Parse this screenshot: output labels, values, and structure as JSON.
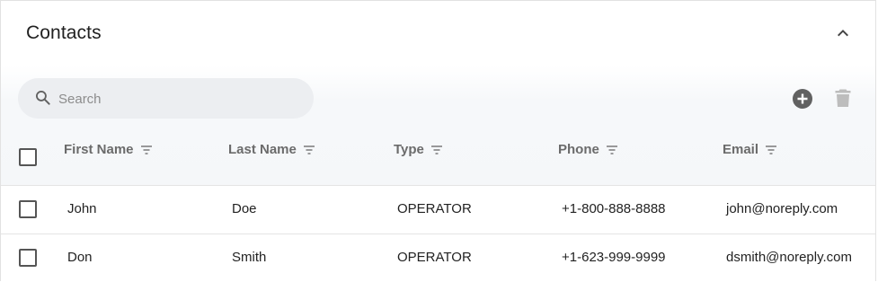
{
  "panel": {
    "title": "Contacts"
  },
  "toolbar": {
    "search_placeholder": "Search",
    "search_value": ""
  },
  "table": {
    "columns": [
      {
        "label": "First Name"
      },
      {
        "label": "Last Name"
      },
      {
        "label": "Type"
      },
      {
        "label": "Phone"
      },
      {
        "label": "Email"
      }
    ],
    "rows": [
      {
        "first": "John",
        "last": "Doe",
        "type": "OPERATOR",
        "phone": "+1-800-888-8888",
        "email": "john@noreply.com"
      },
      {
        "first": "Don",
        "last": "Smith",
        "type": "OPERATOR",
        "phone": "+1-623-999-9999",
        "email": "dsmith@noreply.com"
      }
    ]
  },
  "colors": {
    "icon_dark": "#616161",
    "icon_light": "#bdbdbd",
    "header_bg": "#f5f7f9"
  }
}
